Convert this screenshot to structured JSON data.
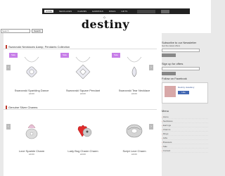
{
  "topnav": {
    "items": [
      "HOME",
      "NECKLACES",
      "CHARMS",
      "EARRINGS",
      "RINGS",
      "GIFTS"
    ],
    "search_placeholder": "",
    "search_button": ""
  },
  "header": {
    "logo": "destiny",
    "gem": "◇"
  },
  "search": {
    "placeholder": "Search",
    "button": "Search"
  },
  "sections": [
    {
      "title": "Swarovski Necklaces &amp; Pendants Collection",
      "products": [
        {
          "ribbon": "Sale",
          "name": "Swarovski Sparkling Dance",
          "price": "£0.00"
        },
        {
          "ribbon": "Sale",
          "name": "Swarovski Square Pendant",
          "price": "£0.00"
        },
        {
          "ribbon": "Sale",
          "name": "Swarovski Tear Necklace",
          "price": "£0.00"
        }
      ]
    },
    {
      "title": "Genuine Silver Charms",
      "products": [
        {
          "ribbon": "",
          "name": "Love Sparkle Charm",
          "price": "£0.00"
        },
        {
          "ribbon": "",
          "name": "Lady Bug Charm Charm",
          "price": "£0.00"
        },
        {
          "ribbon": "",
          "name": "Script Love Charm",
          "price": "£0.00"
        }
      ]
    }
  ],
  "sidebar": {
    "newsletter_title": "Subscribe to our Newsletter",
    "newsletter_text": "Get the latest offers",
    "signup_title": "Sign up for offers",
    "fb_title": "Follow on Facebook",
    "fb_name": "Destiny Jewellery",
    "fb_like": "Like",
    "menu_title": "Menu",
    "menu_items": [
      "Home",
      "Necklaces",
      "Earrings",
      "Charms",
      "Rings",
      "Gifts",
      "Bracelets",
      "Sale",
      "Contact"
    ]
  },
  "colors": {
    "accent": "#c0392b",
    "ribbon": "#c77ee8",
    "nav": "#222222",
    "bg": "#e9e9e9"
  }
}
